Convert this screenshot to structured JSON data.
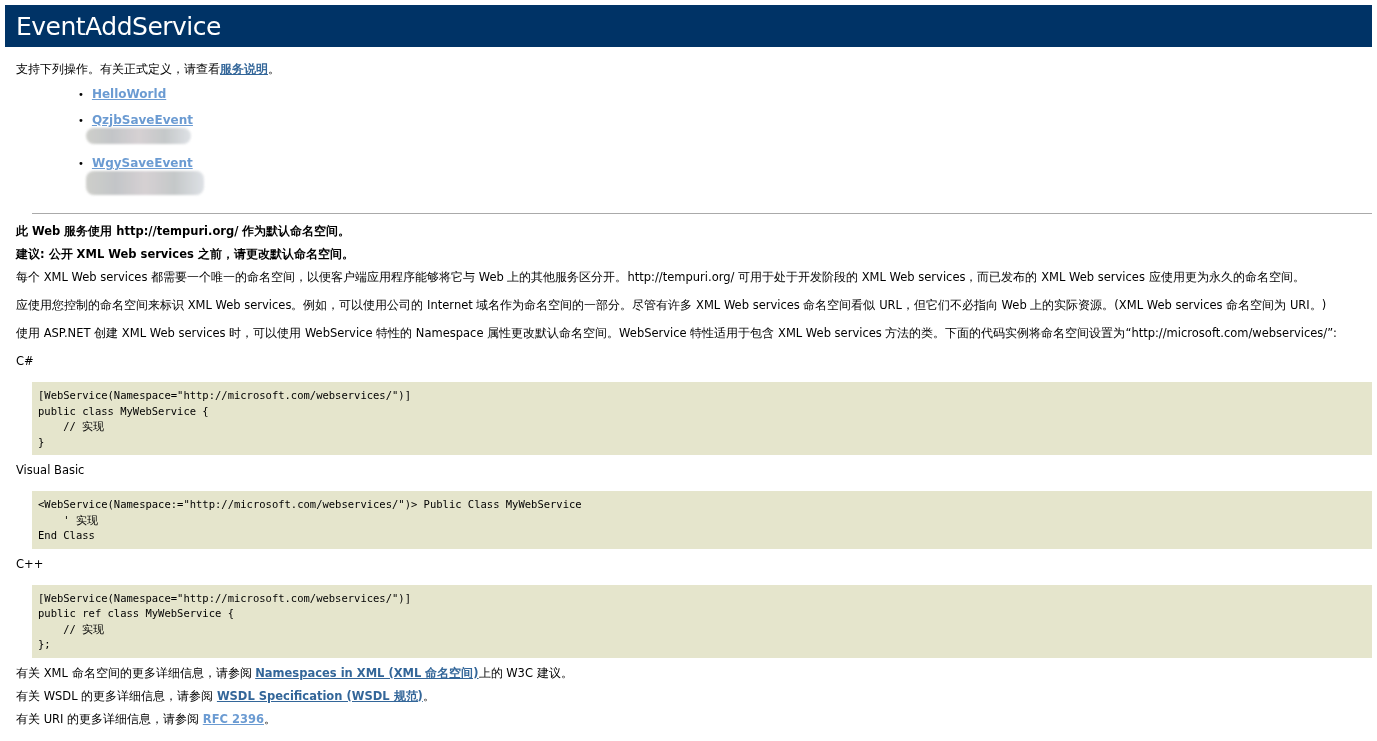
{
  "header": {
    "title": "EventAddService"
  },
  "intro": {
    "before": "支持下列操作。有关正式定义，请查看",
    "link": {
      "text": "服务说明",
      "visited": true
    },
    "after": "。"
  },
  "operations": [
    {
      "marker": "•",
      "text": "HelloWorld",
      "visited": false,
      "redacted": false
    },
    {
      "marker": "•",
      "text": "QzjbSaveEvent",
      "visited": false,
      "redacted": true
    },
    {
      "marker": "•",
      "text": "WgySaveEvent",
      "visited": false,
      "redacted": true
    }
  ],
  "blocks": [
    {
      "kind": "bold",
      "text": "此 Web 服务使用 http://tempuri.org/ 作为默认命名空间。"
    },
    {
      "kind": "bold",
      "text": "建议: 公开 XML Web services 之前，请更改默认命名空间。"
    },
    {
      "kind": "text",
      "text": "每个 XML Web services 都需要一个唯一的命名空间，以便客户端应用程序能够将它与 Web 上的其他服务区分开。http://tempuri.org/ 可用于处于开发阶段的 XML Web services，而已发布的 XML Web services 应使用更为永久的命名空间。"
    },
    {
      "kind": "text",
      "text": "应使用您控制的命名空间来标识 XML Web services。例如，可以使用公司的 Internet 域名作为命名空间的一部分。尽管有许多 XML Web services 命名空间看似 URL，但它们不必指向 Web 上的实际资源。(XML Web services 命名空间为 URI。)"
    },
    {
      "kind": "text",
      "text": "使用 ASP.NET 创建 XML Web services 时，可以使用 WebService 特性的 Namespace 属性更改默认命名空间。WebService 特性适用于包含 XML Web services 方法的类。下面的代码实例将命名空间设置为“http://microsoft.com/webservices/”:"
    },
    {
      "kind": "text",
      "text": "C#"
    },
    {
      "kind": "code",
      "lines": [
        "[WebService(Namespace=\"http://microsoft.com/webservices/\")]",
        "public class MyWebService {",
        "    // 实现",
        "}"
      ]
    },
    {
      "kind": "text",
      "text": "Visual Basic"
    },
    {
      "kind": "code",
      "lines": [
        "<WebService(Namespace:=\"http://microsoft.com/webservices/\")> Public Class MyWebService",
        "    ' 实现",
        "End Class"
      ]
    },
    {
      "kind": "text",
      "text": "C++"
    },
    {
      "kind": "code",
      "lines": [
        "[WebService(Namespace=\"http://microsoft.com/webservices/\")]",
        "public ref class MyWebService {",
        "    // 实现",
        "};"
      ]
    },
    {
      "kind": "linked",
      "before": "有关 XML 命名空间的更多详细信息，请参阅 ",
      "link": {
        "text": "Namespaces in XML (XML 命名空间)",
        "visited": true
      },
      "after": "上的 W3C 建议。"
    },
    {
      "kind": "linked",
      "before": "有关 WSDL 的更多详细信息，请参阅 ",
      "link": {
        "text": "WSDL Specification (WSDL 规范)",
        "visited": true
      },
      "after": "。"
    },
    {
      "kind": "linked",
      "before": "有关 URI 的更多详细信息，请参阅 ",
      "link": {
        "text": "RFC 2396",
        "visited": false
      },
      "after": "。"
    }
  ]
}
